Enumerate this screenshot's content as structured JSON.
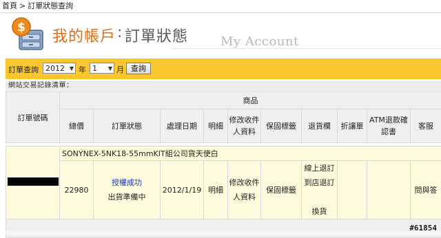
{
  "breadcrumb": {
    "home": "首頁",
    "separator": ">",
    "current": "訂單狀態查詢"
  },
  "header": {
    "title_main": "我的帳戶",
    "colon": ":",
    "title_sub": "訂單狀態",
    "title_en": "My Account"
  },
  "search": {
    "label": "訂單查詢",
    "year_value": "2012",
    "year_unit": "年",
    "month_value": "1",
    "month_unit": "月",
    "button": "查詢"
  },
  "section_title": "網站交易記錄清單：",
  "table": {
    "col_order_no": "訂單號碼",
    "col_product": "商品",
    "sub_headers": {
      "total": "總價",
      "status": "訂單狀態",
      "date": "處理日期",
      "detail": "明細",
      "edit_recipient_1": "修改收件",
      "edit_recipient_2": "人資料",
      "warranty": "保固標籤",
      "return": "退貨欄",
      "discount": "折讓單",
      "atm_1": "ATM退款確",
      "atm_2": "認書",
      "service": "客服"
    },
    "order": {
      "product_name": "SONYNEX-5NK18-55mmKIT組公司貨天使白",
      "total": "22980",
      "status_link": "授權成功",
      "status_text": "出貨準備中",
      "date": "2012/1/19",
      "detail": "明細",
      "edit_recipient_1": "修改收件",
      "edit_recipient_2": "人資料",
      "warranty": "保固標籤",
      "return_1": "線上退訂",
      "return_2": "到店退訂",
      "return_3": "換貨",
      "service": "問與答"
    }
  },
  "watermark": "#61854",
  "colors": {
    "accent_orange": "#e06d14",
    "search_bar": "#fac82e",
    "row_bg": "#fefcdc",
    "link": "#1a33b5"
  },
  "icons": {
    "logo": "money-drawer-icon",
    "dropdown": "chevron-down-icon"
  }
}
